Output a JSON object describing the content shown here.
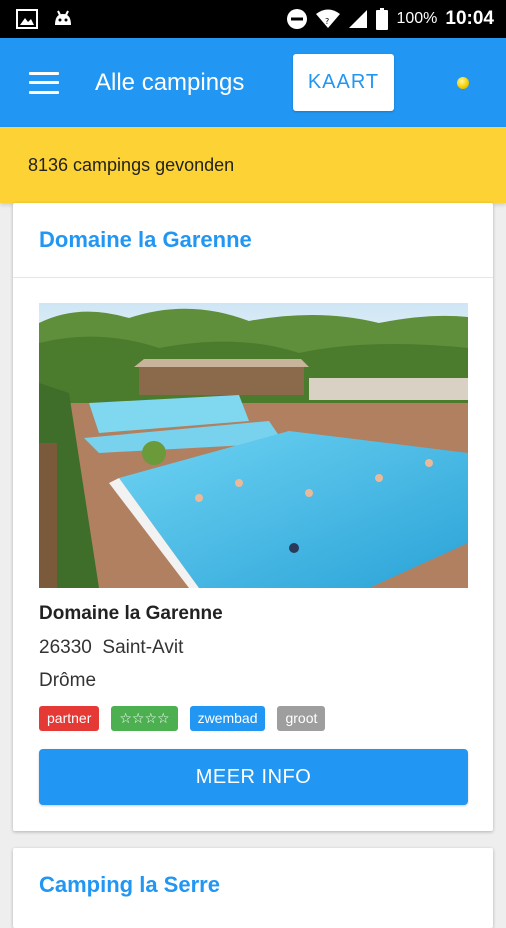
{
  "status_bar": {
    "battery": "100%",
    "time": "10:04"
  },
  "app_bar": {
    "title": "Alle campings",
    "map_button": "KAART"
  },
  "results": {
    "count_text": "8136 campings gevonden"
  },
  "campings": [
    {
      "title": "Domaine la Garenne",
      "name": "Domaine la Garenne",
      "postal_code": "26330",
      "town": "Saint-Avit",
      "address": "26330  Saint-Avit",
      "region": "Drôme",
      "tags": [
        {
          "label": "partner",
          "color": "#e53935"
        },
        {
          "label": "☆☆☆☆",
          "color": "#4caf50"
        },
        {
          "label": "zwembad",
          "color": "#2196f3"
        },
        {
          "label": "groot",
          "color": "#9e9e9e"
        }
      ],
      "more_info_label": "MEER INFO"
    },
    {
      "title": "Camping la Serre"
    }
  ],
  "colors": {
    "primary": "#2196f3",
    "accent_bar": "#fcd234"
  }
}
